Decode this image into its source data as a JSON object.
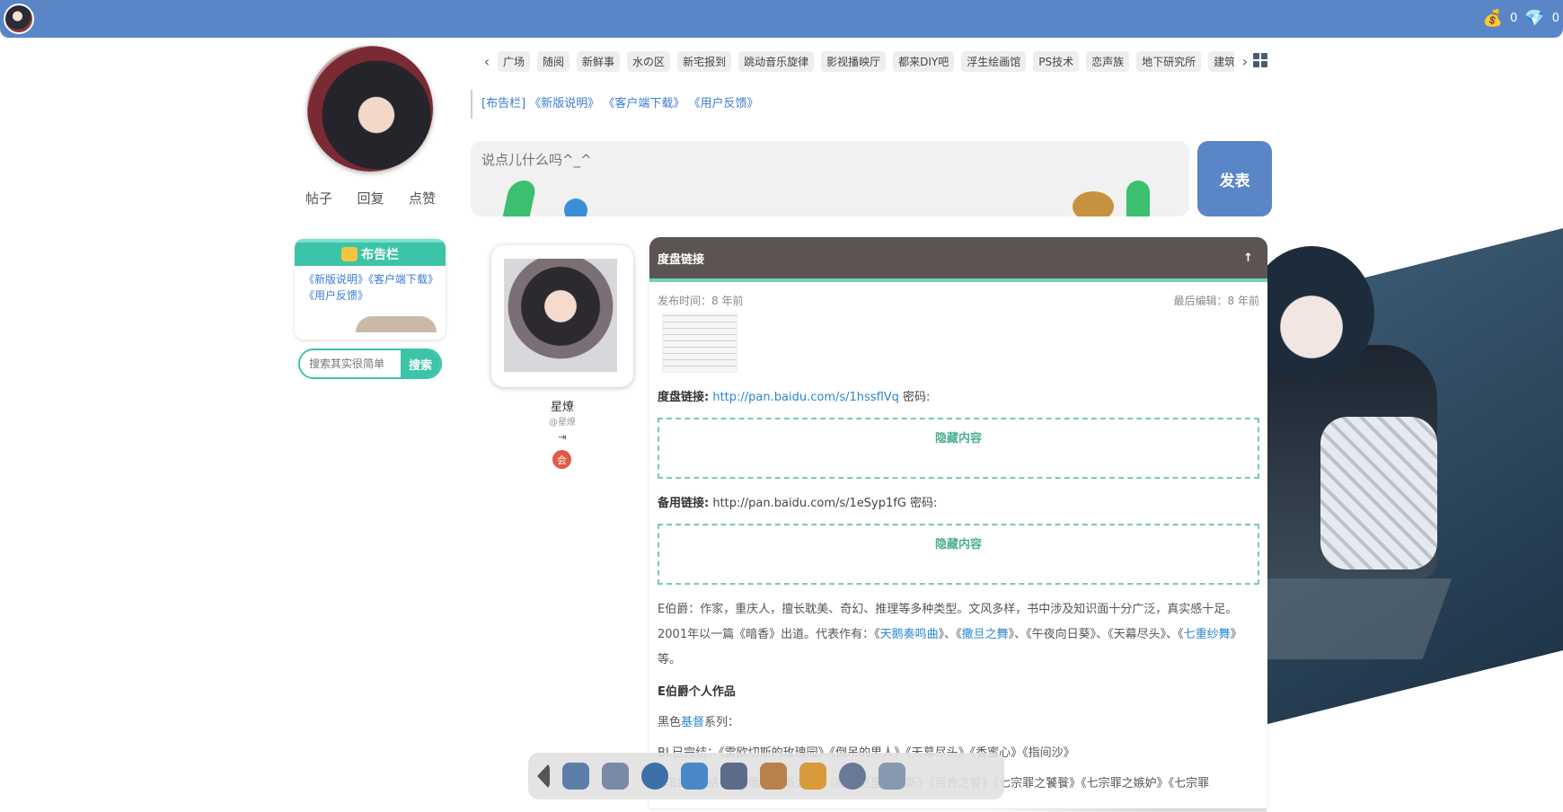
{
  "topbar": {
    "coins": "0",
    "gems": "0"
  },
  "profile": {
    "stats": [
      "帖子",
      "回复",
      "点赞"
    ]
  },
  "board": {
    "title": "布告栏",
    "links": "《新版说明》《客户端下载》《用户反馈》"
  },
  "search": {
    "placeholder": "搜索其实很简单",
    "button": "搜索"
  },
  "nav": {
    "tabs": [
      "广场",
      "随阅",
      "新鲜事",
      "水の区",
      "新宅报到",
      "跳动音乐旋律",
      "影视播映厅",
      "都来DIY吧",
      "浮生绘画馆",
      "PS技术",
      "恋声族",
      "地下研究所",
      "建筑"
    ]
  },
  "notice": "[布告栏] 《新版说明》 《客户端下载》 《用户反馈》",
  "composer": {
    "placeholder": "说点儿什么吗^_^",
    "post_button": "发表"
  },
  "author": {
    "name": "星燎",
    "handle": "@星燎",
    "action": "⇥",
    "badge": "会"
  },
  "post": {
    "title": "度盘链接",
    "published": "发布时间：8 年前",
    "edited": "最后编辑：8 年前",
    "link1_label": "度盘链接:",
    "link1_url": "http://pan.baidu.com/s/1hssflVq",
    "link1_suffix": "密码:",
    "hidden1": "隐藏内容",
    "link2_label": "备用链接:",
    "link2_text": "http://pan.baidu.com/s/1eSyp1fG 密码:",
    "hidden2": "隐藏内容",
    "bio_1": "E伯爵：作家，重庆人，擅长耽美、奇幻、推理等多种类型。文风多样，书中涉及知识面十分广泛，真实感十足。",
    "bio_2a": "2001年以一篇《暗香》出道。代表作有：《",
    "bio_2b": "天鹅奏鸣曲",
    "bio_2c": "》、《",
    "bio_2d": "撒旦之舞",
    "bio_2e": "》、《午夜向日葵》、《天幕尽头》、《",
    "bio_2f": "七重纱舞",
    "bio_2g": "》等。",
    "works_heading": "E伯爵个人作品",
    "series_a": "黑色",
    "series_b": "基督",
    "series_c": "系列：",
    "bl_done": "BL已完结：《雷欧切斯的玫瑰园》《倒吊的男人》《天幕尽头》《香蜜心》《指间沙》",
    "non_bl": "非BL已完结：《狄俄尼索斯之祭》《献给厄里厄厄斯》《百合之誓》《七宗罪之饕餮》《七宗罪之嫉妒》《七宗罪"
  }
}
